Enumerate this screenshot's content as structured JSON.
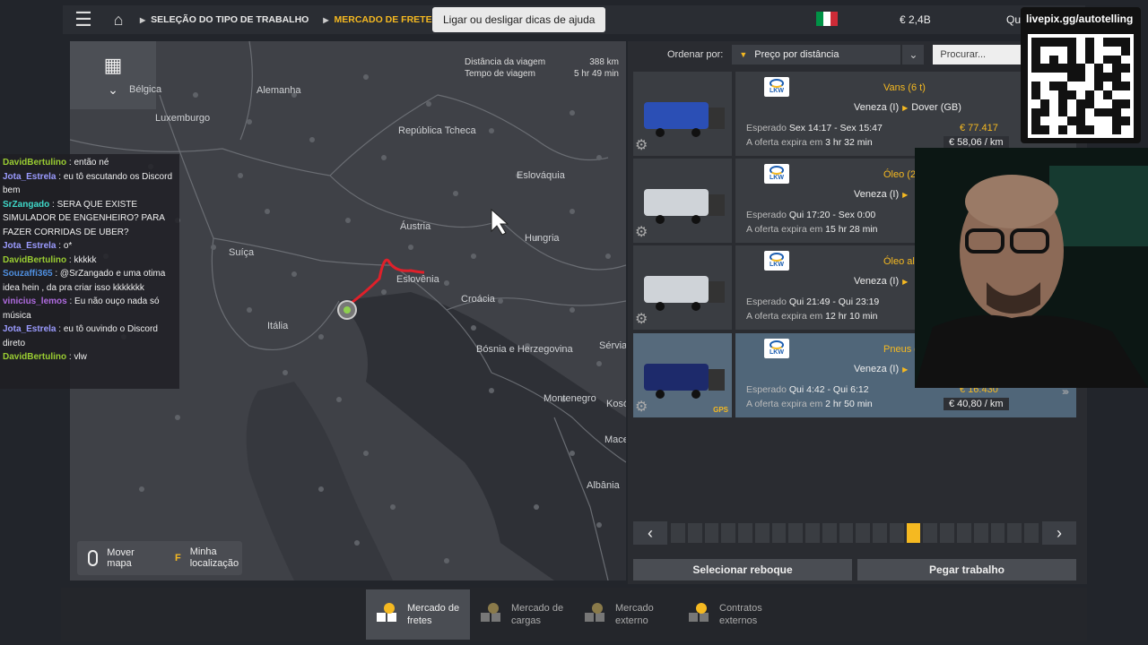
{
  "topbar": {
    "crumb1": "SELEÇÃO DO TIPO DE TRABALHO",
    "crumb2": "MERCADO DE FRETES",
    "help_symbol": "?",
    "tooltip": "Ligar ou desligar dicas de ajuda",
    "money": "€ 2,4B",
    "quick": "Qui"
  },
  "map": {
    "trip_distance_label": "Distância da viagem",
    "trip_distance": "388 km",
    "trip_time_label": "Tempo de viagem",
    "trip_time": "5 hr 49 min",
    "labels": {
      "belgica": "Bélgica",
      "alemanha": "Alemanha",
      "luxemburgo": "Luxemburgo",
      "rep_tcheca": "República Tcheca",
      "eslovaquia": "Eslováquia",
      "austria": "Áustria",
      "hungria": "Hungria",
      "suica": "Suíça",
      "eslovenia": "Eslovênia",
      "croacia": "Croácia",
      "italia": "Itália",
      "bosnia": "Bósnia e Herzegovina",
      "servia": "Sérvia",
      "montenegro": "Montenegro",
      "kosovo": "Kosó",
      "macedonia": "Mace",
      "albania": "Albânia"
    },
    "move_map": "Mover mapa",
    "my_location_key": "F",
    "my_location": "Minha localização"
  },
  "chat": [
    {
      "user": "DavidBertulino",
      "color": "#9acd32",
      "text": ": então né"
    },
    {
      "user": "Jota_Estrela",
      "color": "#9b9bff",
      "text": ": eu tô escutando os Discord bem"
    },
    {
      "user": "SrZangado",
      "color": "#3fd9c9",
      "text": ": SERA QUE EXISTE SIMULADOR DE ENGENHEIRO? PARA FAZER CORRIDAS DE UBER?"
    },
    {
      "user": "Jota_Estrela",
      "color": "#9b9bff",
      "text": ": o*"
    },
    {
      "user": "DavidBertulino",
      "color": "#9acd32",
      "text": ": kkkkk"
    },
    {
      "user": "Souzaffi365",
      "color": "#4f8fe0",
      "text": ": @SrZangado e uma otima idea hein , da pra criar isso kkkkkkk"
    },
    {
      "user": "vinicius_lemos",
      "color": "#b06be0",
      "text": ": Eu não ouço nada só música"
    },
    {
      "user": "Jota_Estrela",
      "color": "#9b9bff",
      "text": ": eu tô ouvindo o Discord direto"
    },
    {
      "user": "DavidBertulino",
      "color": "#9acd32",
      "text": ": vlw"
    }
  ],
  "sort": {
    "label": "Ordenar por:",
    "value": "Preço por distância",
    "search_placeholder": "Procurar..."
  },
  "jobs": [
    {
      "company": "LKW",
      "cargo": "Vans (6 t)",
      "from": "Veneza (I)",
      "to": "Dover (GB)",
      "expected_label": "Esperado",
      "expected": "Sex 14:17 - Sex 15:47",
      "expires_label": "A oferta expira em",
      "expires": "3 hr 32 min",
      "price": "€ 77.417",
      "per_km": "€ 58,06 / km"
    },
    {
      "company": "LKW",
      "cargo": "Óleo (23",
      "from": "Veneza (I)",
      "to": "",
      "expected_label": "Esperado",
      "expected": "Qui 17:20 - Sex 0:00",
      "expires_label": "A oferta expira em",
      "expires": "15 hr 28 min",
      "price": "",
      "per_km": ""
    },
    {
      "company": "LKW",
      "cargo": "Óleo aliment",
      "from": "Veneza (I)",
      "to": "",
      "expected_label": "Esperado",
      "expected": "Qui 21:49 - Qui 23:19",
      "expires_label": "A oferta expira em",
      "expires": "12 hr 10 min",
      "price": "",
      "per_km": ""
    },
    {
      "company": "LKW",
      "cargo": "Pneus de mo",
      "from": "Veneza (I)",
      "to": "",
      "expected_label": "Esperado",
      "expected": "Qui 4:42 - Qui 6:12",
      "expires_label": "A oferta expira em",
      "expires": "2 hr 50 min",
      "price": "€ 16.430",
      "per_km": "€ 40,80 / km",
      "gps": "GPS"
    }
  ],
  "pager": {
    "prev": "‹",
    "next": "›",
    "pages": 22,
    "current": 14
  },
  "actions": {
    "select_trailer": "Selecionar reboque",
    "take_job": "Pegar trabalho"
  },
  "bottom_tabs": [
    {
      "line1": "Mercado de",
      "line2": "fretes"
    },
    {
      "line1": "Mercado de",
      "line2": "cargas"
    },
    {
      "line1": "Mercado",
      "line2": "externo"
    },
    {
      "line1": "Contratos",
      "line2": "externos"
    }
  ],
  "overlay": {
    "qr_label": "livepix.gg/autotelling"
  },
  "colors": {
    "accent": "#f5b921",
    "route": "#e0202a",
    "flag_green": "#009246",
    "flag_white": "#ffffff",
    "flag_red": "#ce2b37"
  }
}
